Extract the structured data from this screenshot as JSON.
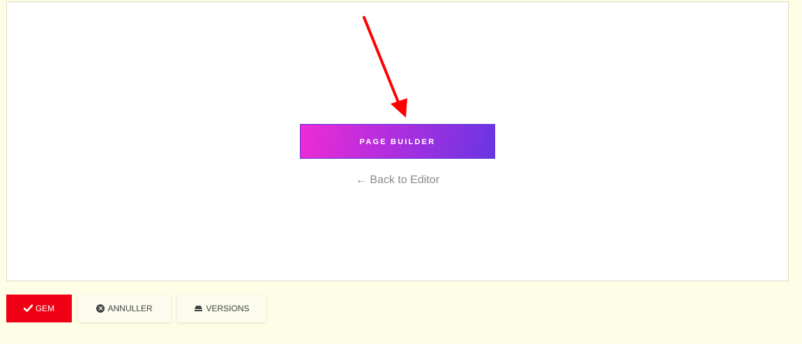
{
  "builder": {
    "page_builder_label": "PAGE BUILDER",
    "back_link_label": "← Back to Editor"
  },
  "toolbar": {
    "save_label": "GEM",
    "cancel_label": "ANNULLER",
    "versions_label": "VERSIONS"
  },
  "icons": {
    "save": "check-icon",
    "cancel": "circle-x-icon",
    "versions": "layers-icon"
  },
  "colors": {
    "page_background": "#fefee6",
    "save_button": "#f00014",
    "annotation_arrow": "#ff0000",
    "gradient_start": "#ee2bd6",
    "gradient_end": "#6a35e3"
  }
}
